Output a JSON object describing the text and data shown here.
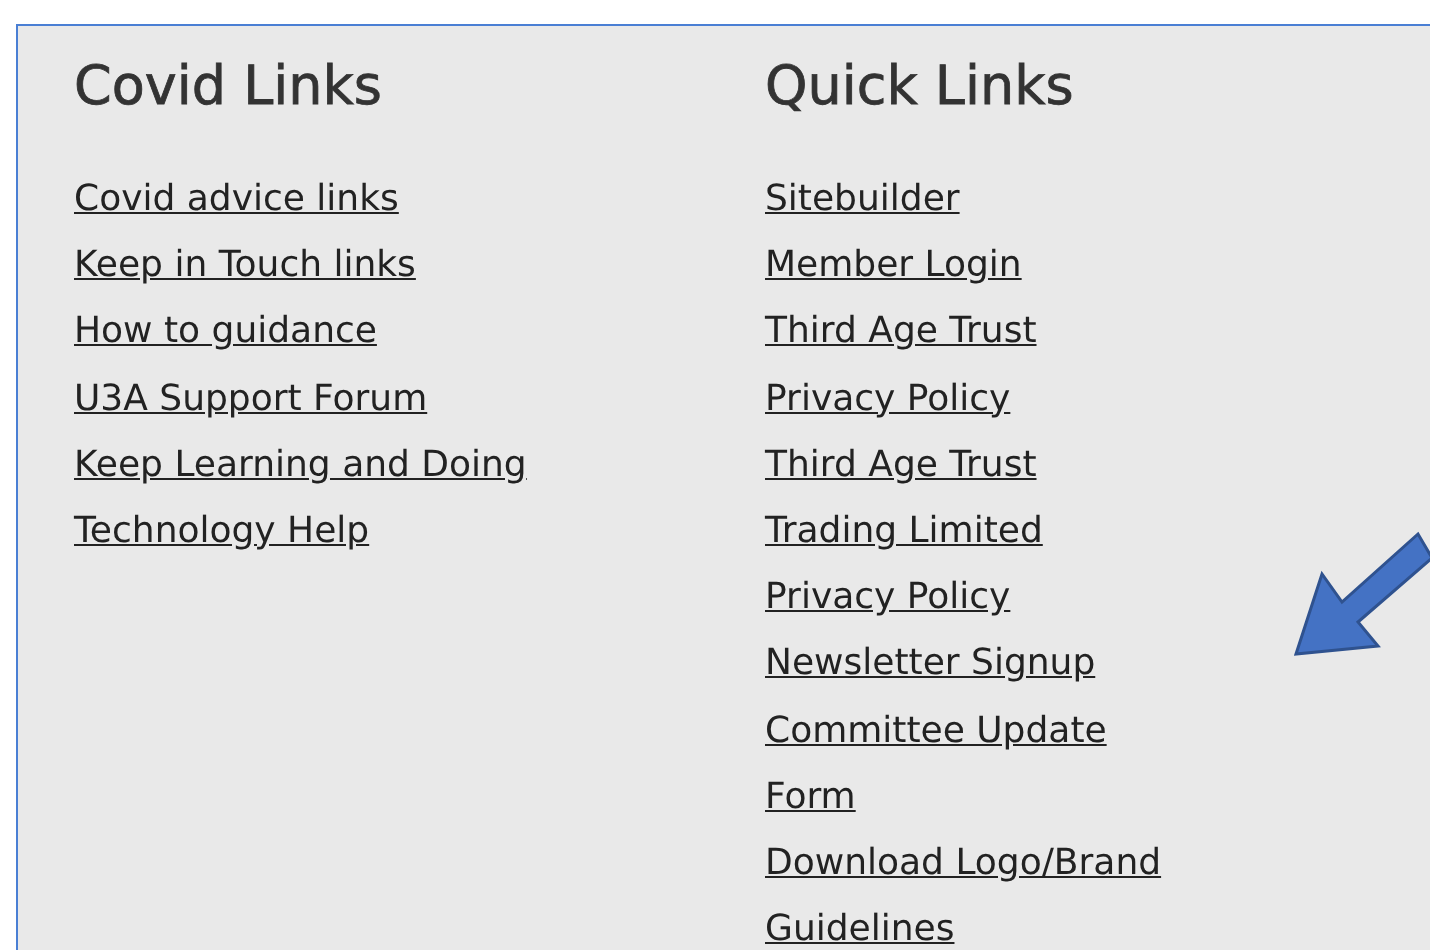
{
  "columns": [
    {
      "heading": "Covid Links",
      "links": [
        {
          "lines": [
            "Covid advice links"
          ]
        },
        {
          "lines": [
            "Keep in Touch links"
          ]
        },
        {
          "lines": [
            "How to guidance"
          ]
        },
        {
          "lines": [
            "U3A Support Forum"
          ]
        },
        {
          "lines": [
            "Keep Learning and Doing"
          ]
        },
        {
          "lines": [
            "Technology Help"
          ]
        }
      ]
    },
    {
      "heading": "Quick Links",
      "links": [
        {
          "lines": [
            "Sitebuilder"
          ]
        },
        {
          "lines": [
            "Member Login"
          ]
        },
        {
          "lines": [
            "Third Age Trust",
            "Privacy Policy"
          ]
        },
        {
          "lines": [
            "Third Age Trust",
            "Trading Limited",
            "Privacy Policy"
          ]
        },
        {
          "lines": [
            "Newsletter Signup"
          ]
        },
        {
          "lines": [
            "Committee Update",
            "Form"
          ]
        },
        {
          "lines": [
            "Download Logo/Brand",
            "Guidelines"
          ]
        }
      ]
    }
  ]
}
